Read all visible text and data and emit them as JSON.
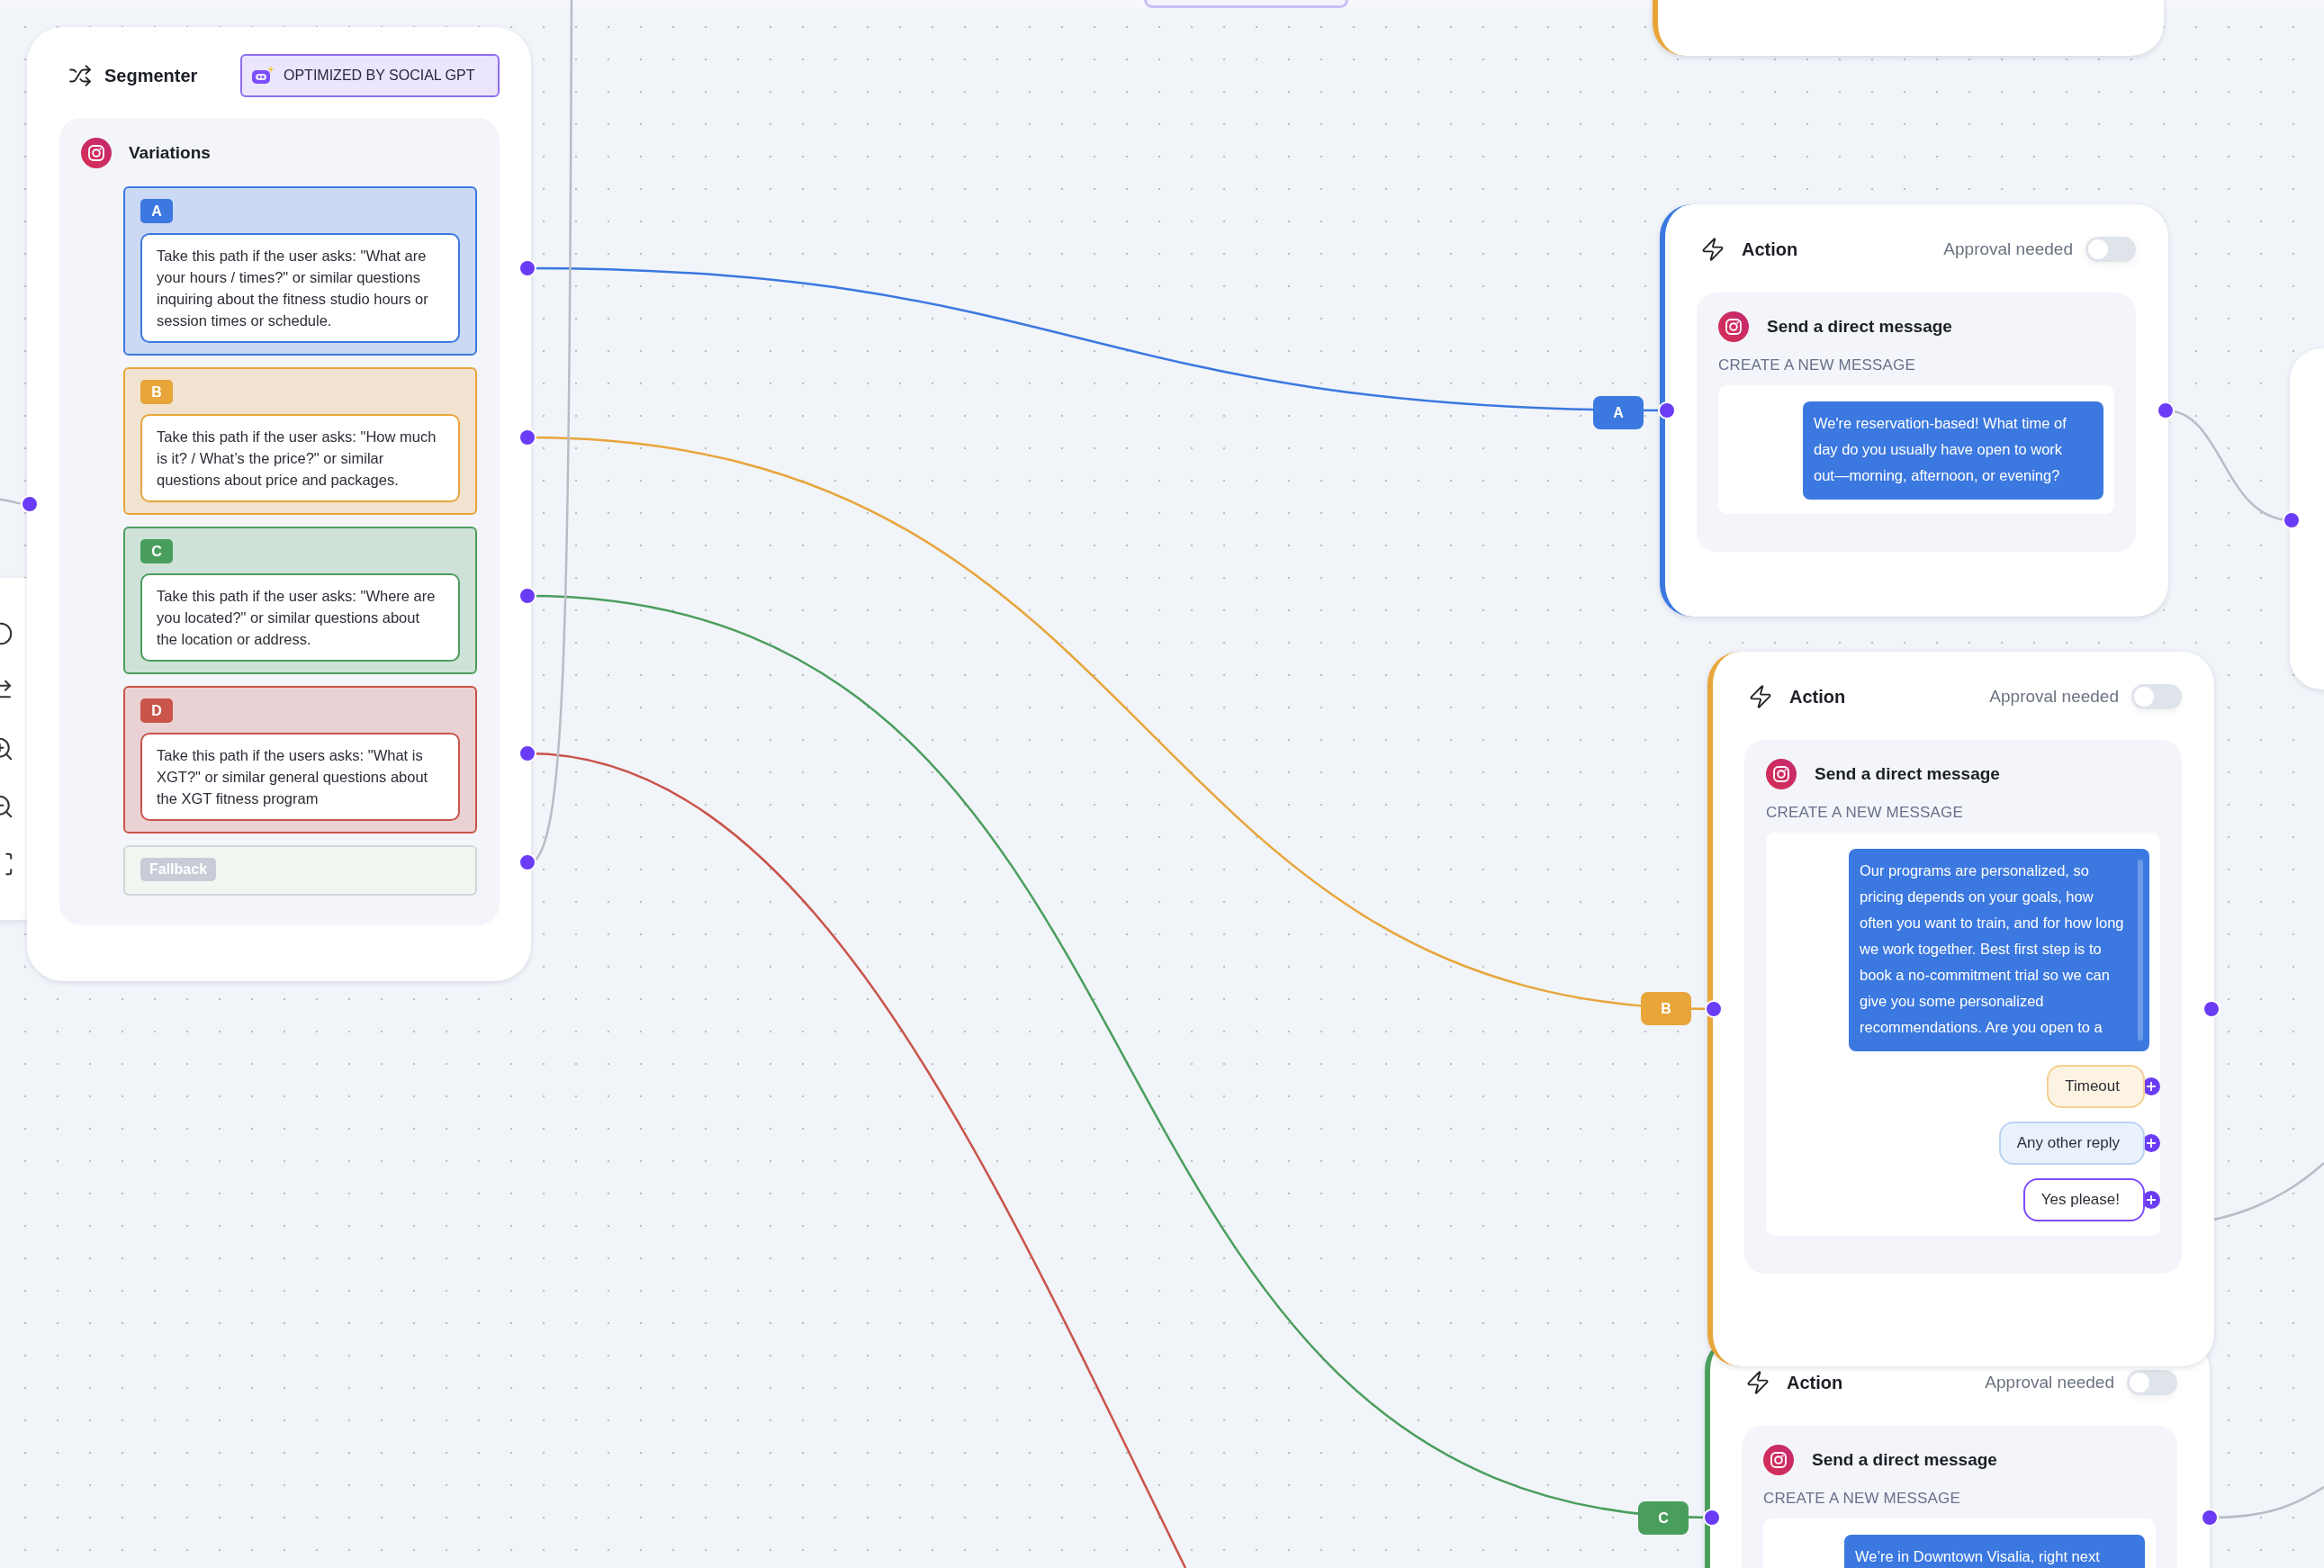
{
  "segmenter": {
    "title": "Segmenter",
    "badge": "OPTIMIZED BY SOCIAL GPT",
    "section_title": "Variations",
    "variations": [
      {
        "letter": "A",
        "color": "#3b78e0",
        "text": "Take this path if the user asks: \"What are your hours / times?\" or similar questions inquiring about the fitness studio hours or session times or schedule."
      },
      {
        "letter": "B",
        "color": "#e8a53a",
        "text": "Take this path if the user asks: \"How much is it? / What’s the price?\" or similar questions about price and packages."
      },
      {
        "letter": "C",
        "color": "#4a9e5c",
        "text": "Take this path if the user asks: \"Where are you located?\" or similar questions about the location or address."
      },
      {
        "letter": "D",
        "color": "#c9544a",
        "text": "Take this path if the users asks: \"What is XGT?\" or similar general questions about the XGT fitness program"
      }
    ],
    "fallback": "Fallback"
  },
  "actions": [
    {
      "path": "A",
      "color": "#3b78e0",
      "title": "Action",
      "approval_label": "Approval needed",
      "approval_on": false,
      "step_title": "Send a direct message",
      "section_label": "CREATE A NEW MESSAGE",
      "message": "We're reservation-based! What time of day do you usually have open to work out—morning, afternoon, or evening?"
    },
    {
      "path": "B",
      "color": "#e8a53a",
      "title": "Action",
      "approval_label": "Approval needed",
      "approval_on": false,
      "step_title": "Send a direct message",
      "section_label": "CREATE A NEW MESSAGE",
      "message": "Our programs are personalized, so pricing depends on your goals, how often you want to train, and for how long we work together. Best first step is to book a no-commitment trial so we can give you some personalized recommendations. Are you open to a",
      "replies": [
        {
          "label": "Timeout",
          "kind": "timeout"
        },
        {
          "label": "Any other reply",
          "kind": "other"
        },
        {
          "label": "Yes please!",
          "kind": "match"
        }
      ]
    },
    {
      "path": "C",
      "color": "#4a9e5c",
      "title": "Action",
      "approval_label": "Approval needed",
      "approval_on": false,
      "step_title": "Send a direct message",
      "section_label": "CREATE A NEW MESSAGE",
      "message": "We’re in Downtown Visalia, right next"
    }
  ]
}
